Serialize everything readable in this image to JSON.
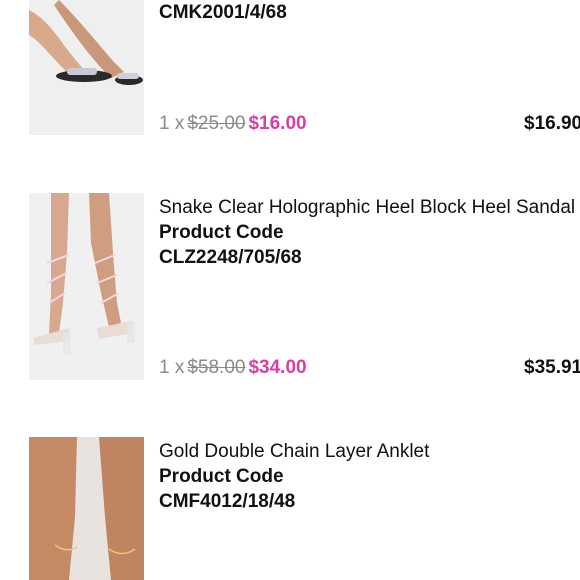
{
  "items": [
    {
      "name": "",
      "code_label": "",
      "code": "CMK2001/4/68",
      "qty": "1 x",
      "was_price": "$25.00",
      "now_price": "$16.00",
      "line_total": "$16.90"
    },
    {
      "name": "Snake Clear Holographic Heel Block Heel Sandal",
      "code_label": "Product Code",
      "code": "CLZ2248/705/68",
      "qty": "1 x",
      "was_price": "$58.00",
      "now_price": "$34.00",
      "line_total": "$35.91"
    },
    {
      "name": "Gold Double Chain Layer Anklet",
      "code_label": "Product Code",
      "code": "CMF4012/18/48"
    }
  ],
  "colors": {
    "sale_price": "#d63fa6",
    "muted": "#8a8a8a",
    "text": "#111111"
  }
}
